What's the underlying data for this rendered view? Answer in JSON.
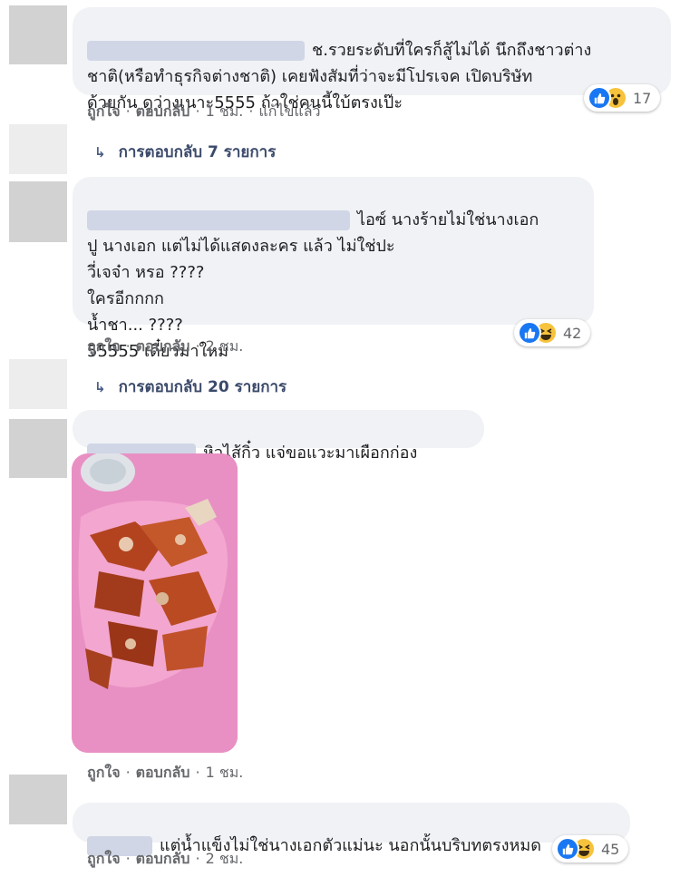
{
  "comments": [
    {
      "text": "ช.รวยระดับที่ใครก็สู้ไม่ได้ นึกถึงชาวต่าง\nชาติ(หรือทำธุรกิจต่างชาติ) เคยฟังสัมที่ว่าจะมีโปรเจค เปิดบริษัท\nด้วยกัน ดูว่างเนาะ5555 ถ้าใช่คนนี้ใบ้ตรงเป๊ะ",
      "like": "ถูกใจ",
      "reply": "ตอบกลับ",
      "time": "1 ชม.",
      "edited": "แก้ไขแล้ว",
      "reaction_count": "17",
      "reactions": [
        "like-icon",
        "wow-icon"
      ]
    },
    {
      "text": "ไอซ์ นางร้ายไม่ใช่นางเอก\nปู นางเอก แต่ไม่ได้แสดงละคร แล้ว ไม่ใช่ปะ\nวี่เจจ๋า หรอ ????\nใครอีกกกก\nน้ำชา... ????\n55555 เดี๋ยวมาใหม่",
      "like": "ถูกใจ",
      "reply": "ตอบกลับ",
      "time": "2 ชม.",
      "reaction_count": "42",
      "reactions": [
        "like-icon",
        "haha-icon"
      ]
    },
    {
      "text": "หิวไส้กิ๋ว แจ่ขอแวะมาเผือกก่อง",
      "like": "ถูกใจ",
      "reply": "ตอบกลับ",
      "time": "1 ชม."
    },
    {
      "text": "แต่น้ำแข็งไม่ใช่นางเอกตัวแม่นะ นอกนั้นบริบทตรงหมด",
      "like": "ถูกใจ",
      "reply": "ตอบกลับ",
      "time": "2 ชม.",
      "reaction_count": "45",
      "reactions": [
        "like-icon",
        "haha-icon"
      ]
    }
  ],
  "reply_threads": [
    {
      "label": "การตอบกลับ 7 รายการ",
      "icon": "reply-arrow-icon"
    },
    {
      "label": "การตอบกลับ 20 รายการ",
      "icon": "reply-arrow-icon"
    }
  ],
  "colors": {
    "bubble": "#f0f2f5",
    "like_blue": "#1877f2",
    "face_yellow": "#f7c33c",
    "meta_gray": "#65676b",
    "photo_plate": "#e88bc0"
  }
}
